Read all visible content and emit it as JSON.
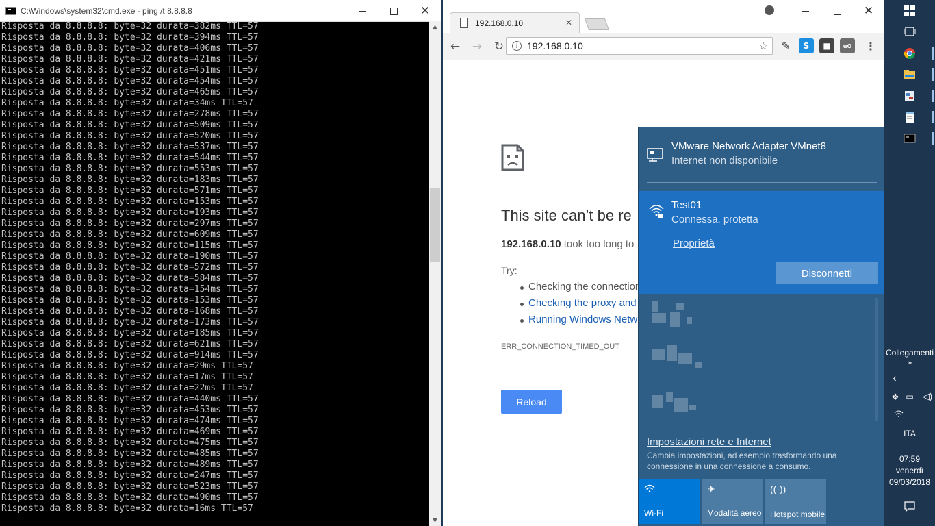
{
  "cmd": {
    "title": "C:\\Windows\\system32\\cmd.exe - ping  /t 8.8.8.8",
    "lines": [
      "Risposta da 8.8.8.8: byte=32 durata=382ms TTL=57",
      "Risposta da 8.8.8.8: byte=32 durata=394ms TTL=57",
      "Risposta da 8.8.8.8: byte=32 durata=406ms TTL=57",
      "Risposta da 8.8.8.8: byte=32 durata=421ms TTL=57",
      "Risposta da 8.8.8.8: byte=32 durata=451ms TTL=57",
      "Risposta da 8.8.8.8: byte=32 durata=454ms TTL=57",
      "Risposta da 8.8.8.8: byte=32 durata=465ms TTL=57",
      "Risposta da 8.8.8.8: byte=32 durata=34ms TTL=57",
      "Risposta da 8.8.8.8: byte=32 durata=278ms TTL=57",
      "Risposta da 8.8.8.8: byte=32 durata=509ms TTL=57",
      "Risposta da 8.8.8.8: byte=32 durata=520ms TTL=57",
      "Risposta da 8.8.8.8: byte=32 durata=537ms TTL=57",
      "Risposta da 8.8.8.8: byte=32 durata=544ms TTL=57",
      "Risposta da 8.8.8.8: byte=32 durata=553ms TTL=57",
      "Risposta da 8.8.8.8: byte=32 durata=183ms TTL=57",
      "Risposta da 8.8.8.8: byte=32 durata=571ms TTL=57",
      "Risposta da 8.8.8.8: byte=32 durata=153ms TTL=57",
      "Risposta da 8.8.8.8: byte=32 durata=193ms TTL=57",
      "Risposta da 8.8.8.8: byte=32 durata=297ms TTL=57",
      "Risposta da 8.8.8.8: byte=32 durata=609ms TTL=57",
      "Risposta da 8.8.8.8: byte=32 durata=115ms TTL=57",
      "Risposta da 8.8.8.8: byte=32 durata=190ms TTL=57",
      "Risposta da 8.8.8.8: byte=32 durata=572ms TTL=57",
      "Risposta da 8.8.8.8: byte=32 durata=584ms TTL=57",
      "Risposta da 8.8.8.8: byte=32 durata=154ms TTL=57",
      "Risposta da 8.8.8.8: byte=32 durata=153ms TTL=57",
      "Risposta da 8.8.8.8: byte=32 durata=168ms TTL=57",
      "Risposta da 8.8.8.8: byte=32 durata=173ms TTL=57",
      "Risposta da 8.8.8.8: byte=32 durata=185ms TTL=57",
      "Risposta da 8.8.8.8: byte=32 durata=621ms TTL=57",
      "Risposta da 8.8.8.8: byte=32 durata=914ms TTL=57",
      "Risposta da 8.8.8.8: byte=32 durata=29ms TTL=57",
      "Risposta da 8.8.8.8: byte=32 durata=17ms TTL=57",
      "Risposta da 8.8.8.8: byte=32 durata=22ms TTL=57",
      "Risposta da 8.8.8.8: byte=32 durata=440ms TTL=57",
      "Risposta da 8.8.8.8: byte=32 durata=453ms TTL=57",
      "Risposta da 8.8.8.8: byte=32 durata=474ms TTL=57",
      "Risposta da 8.8.8.8: byte=32 durata=469ms TTL=57",
      "Risposta da 8.8.8.8: byte=32 durata=475ms TTL=57",
      "Risposta da 8.8.8.8: byte=32 durata=485ms TTL=57",
      "Risposta da 8.8.8.8: byte=32 durata=489ms TTL=57",
      "Risposta da 8.8.8.8: byte=32 durata=247ms TTL=57",
      "Risposta da 8.8.8.8: byte=32 durata=523ms TTL=57",
      "Risposta da 8.8.8.8: byte=32 durata=490ms TTL=57",
      "Risposta da 8.8.8.8: byte=32 durata=16ms TTL=57"
    ]
  },
  "chrome": {
    "tab_title": "192.168.0.10",
    "url": "192.168.0.10",
    "error_title": "This site can’t be re",
    "desc_host": "192.168.0.10",
    "desc_rest": " took too long to",
    "try_label": "Try:",
    "suggestions": [
      "Checking the connection",
      "Checking the proxy and",
      "Running Windows Netw"
    ],
    "error_code": "ERR_CONNECTION_TIMED_OUT",
    "reload_label": "Reload"
  },
  "flyout": {
    "adapter_name": "VMware Network Adapter VMnet8",
    "adapter_status": "Internet non disponibile",
    "wifi_ssid": "Test01",
    "wifi_status": "Connessa, protetta",
    "properties_link": "Proprietà",
    "disconnect_label": "Disconnetti",
    "settings_link": "Impostazioni rete e Internet",
    "settings_desc": "Cambia impostazioni, ad esempio trasformando una connessione in una connessione a consumo.",
    "quick_actions": [
      {
        "label": "Wi-Fi",
        "icon": "wifi-icon"
      },
      {
        "label": "Modalità aereo",
        "icon": "airplane-icon"
      },
      {
        "label": "Hotspot mobile",
        "icon": "hotspot-icon"
      }
    ]
  },
  "taskbar": {
    "links_label": "Collegamenti",
    "language": "ITA",
    "time": "07:59",
    "day": "venerdì",
    "date": "09/03/2018"
  },
  "colors": {
    "flyout_bg": "#2e5e86",
    "wifi_selected": "#1d70c2",
    "reload_button": "#4a8af4",
    "taskbar_bg": "#1e3550"
  }
}
